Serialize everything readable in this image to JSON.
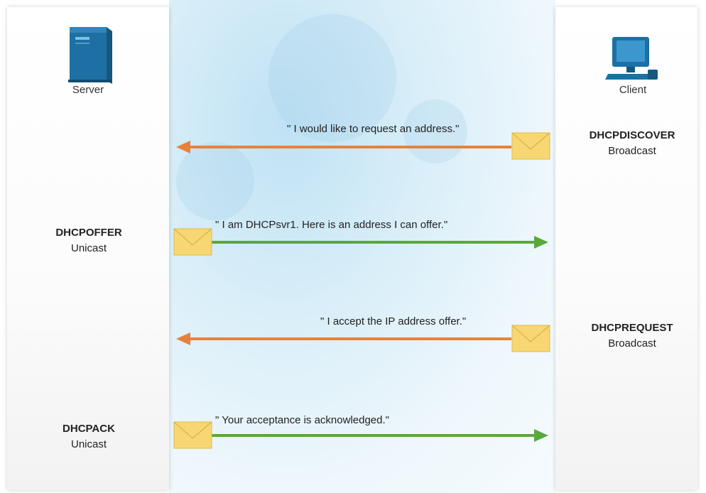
{
  "server": {
    "label": "Server"
  },
  "client": {
    "label": "Client"
  },
  "messages": [
    {
      "name": "DHCPDISCOVER",
      "mode": "Broadcast",
      "quote": "\" I would like to request an address.\"",
      "direction": "client-to-server",
      "color": "#e8823a"
    },
    {
      "name": "DHCPOFFER",
      "mode": "Unicast",
      "quote": "\" I am DHCPsvr1. Here is an address I can offer.\"",
      "direction": "server-to-client",
      "color": "#5aa83c"
    },
    {
      "name": "DHCPREQUEST",
      "mode": "Broadcast",
      "quote": "\" I accept the IP address offer.\"",
      "direction": "client-to-server",
      "color": "#e8823a"
    },
    {
      "name": "DHCPACK",
      "mode": "Unicast",
      "quote": "\" Your acceptance is acknowledged.\"",
      "direction": "server-to-client",
      "color": "#5aa83c"
    }
  ],
  "icons": {
    "server": "server-tower-icon",
    "client": "desktop-computer-icon",
    "message": "envelope-icon"
  },
  "colors": {
    "server_icon": "#1e6fa3",
    "client_icon": "#1e6fa3",
    "envelope_fill": "#f7d774",
    "envelope_stroke": "#e0b84a"
  }
}
